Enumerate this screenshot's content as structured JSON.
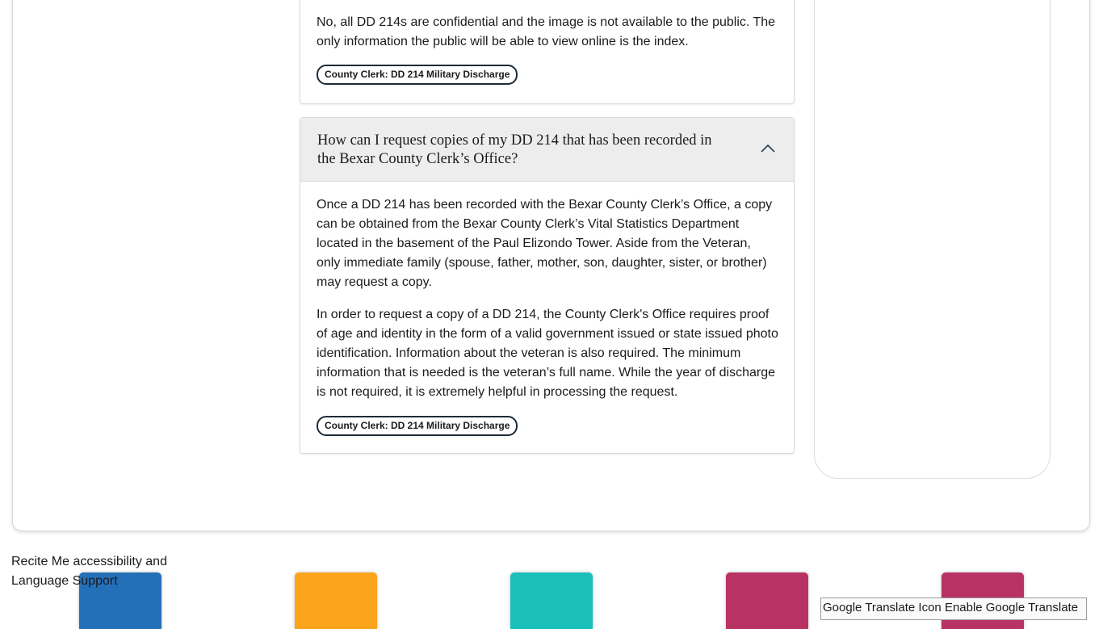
{
  "faq_previous": {
    "answer": "No, all DD 214s are confidential and the image is not available to the public. The only information the public will be able to view online is the index.",
    "tag": "County Clerk: DD 214 Military Discharge"
  },
  "faq_current": {
    "question": "How can I request copies of my DD 214 that has been recorded in the Bexar County Clerk’s Office?",
    "answer_paragraphs": [
      "Once a DD 214 has been recorded with the Bexar County Clerk’s Office, a copy can be obtained from the Bexar County Clerk’s Vital Statistics Department located in the basement of the Paul Elizondo Tower. Aside from the Veteran, only immediate family (spouse, father, mother, son, daughter, sister, or brother) may request a copy.",
      "In order to request a copy of a DD 214, the County Clerk's Office requires proof of age and identity in the form of a valid government issued or state issued photo identification. Information about the veteran is also required. The minimum information that is needed is the veteran’s full name. While the year of discharge is not required, it is extremely helpful in processing the request."
    ],
    "tag": "County Clerk: DD 214 Military Discharge",
    "toggle_icon": "chevron-up-icon"
  },
  "footer": {
    "recite_alt": "Recite Me accessibility and Language Support",
    "google_translate_alt": "Google Translate Icon",
    "google_translate_label": "Enable Google Translate",
    "tile_colors": [
      "#2470b8",
      "#fca41c",
      "#1bbfba",
      "#b83263",
      "#b83263"
    ]
  }
}
